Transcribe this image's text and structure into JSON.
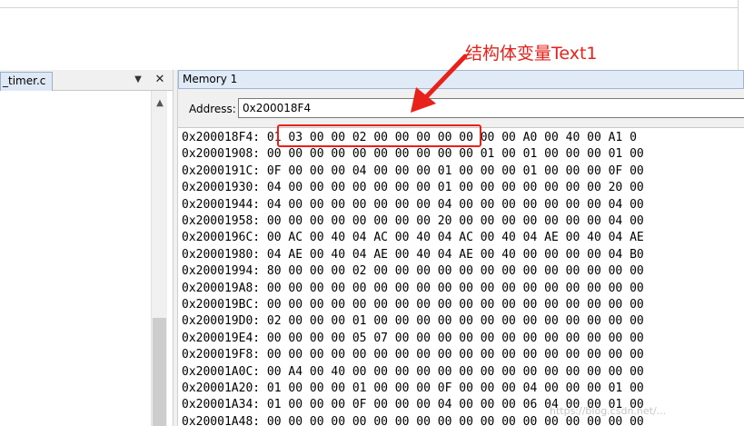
{
  "left_panel": {
    "tab_label": "_timer.c",
    "pin_icon": "pin-icon",
    "close_icon": "close-icon"
  },
  "memory_window": {
    "title": "Memory 1",
    "address_label": "Address:",
    "address_value": "0x200018F4",
    "rows": [
      {
        "addr": "0x200018F4:",
        "bytes": "01 03 00 00 02 00 00 00 00 00 00 00 A0 00 40 00 A1 0"
      },
      {
        "addr": "0x20001908:",
        "bytes": "00 00 00 00 00 00 00 00 00 00 01 00 01 00 00 00 01 00"
      },
      {
        "addr": "0x2000191C:",
        "bytes": "0F 00 00 00 04 00 00 00 01 00 00 00 01 00 00 00 0F 00"
      },
      {
        "addr": "0x20001930:",
        "bytes": "04 00 00 00 00 00 00 00 01 00 00 00 00 00 00 00 20 00"
      },
      {
        "addr": "0x20001944:",
        "bytes": "04 00 00 00 00 00 00 00 04 00 00 00 00 00 00 00 04 00"
      },
      {
        "addr": "0x20001958:",
        "bytes": "00 00 00 00 00 00 00 00 20 00 00 00 00 00 00 00 04 00"
      },
      {
        "addr": "0x2000196C:",
        "bytes": "00 AC 00 40 04 AC 00 40 04 AC 00 40 04 AE 00 40 04 AE"
      },
      {
        "addr": "0x20001980:",
        "bytes": "04 AE 00 40 04 AE 00 40 04 AE 00 40 00 00 00 00 04 B0"
      },
      {
        "addr": "0x20001994:",
        "bytes": "80 00 00 00 02 00 00 00 00 00 00 00 00 00 00 00 00 00"
      },
      {
        "addr": "0x200019A8:",
        "bytes": "00 00 00 00 00 00 00 00 00 00 00 00 00 00 00 00 00 00"
      },
      {
        "addr": "0x200019BC:",
        "bytes": "00 00 00 00 00 00 00 00 00 00 00 00 00 00 00 00 00 00"
      },
      {
        "addr": "0x200019D0:",
        "bytes": "02 00 00 00 01 00 00 00 00 00 00 00 00 00 00 00 00 00"
      },
      {
        "addr": "0x200019E4:",
        "bytes": "00 00 00 00 05 07 00 00 00 00 00 00 00 00 00 00 00 00"
      },
      {
        "addr": "0x200019F8:",
        "bytes": "00 00 00 00 00 00 00 00 00 00 00 00 00 00 00 00 00 00"
      },
      {
        "addr": "0x20001A0C:",
        "bytes": "00 A4 00 40 00 00 00 00 00 00 00 00 00 00 00 00 00 00"
      },
      {
        "addr": "0x20001A20:",
        "bytes": "01 00 00 00 01 00 00 00 0F 00 00 00 04 00 00 00 01 00"
      },
      {
        "addr": "0x20001A34:",
        "bytes": "01 00 00 00 0F 00 00 00 04 00 00 00 06 04 00 00 01 00"
      },
      {
        "addr": "0x20001A48:",
        "bytes": "00 00 00 00 00 00 00 00 00 00 00 00 00 00 00 00 00 00"
      }
    ]
  },
  "annotation": {
    "label": "结构体变量Text1",
    "color": "#e8221b"
  },
  "watermark": "https://blog.csdn.net/..."
}
